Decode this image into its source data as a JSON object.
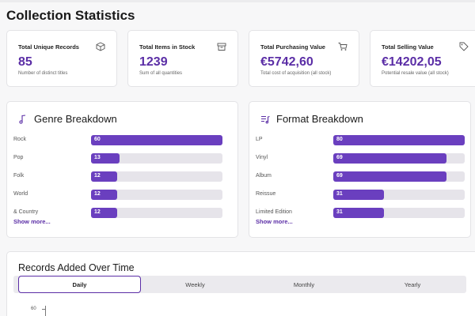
{
  "page": {
    "title": "Collection Statistics"
  },
  "stats": [
    {
      "label": "Total Unique Records",
      "value": "85",
      "sub": "Number of distinct titles",
      "icon": "box-icon"
    },
    {
      "label": "Total Items in Stock",
      "value": "1239",
      "sub": "Sum of all quantities",
      "icon": "archive-icon"
    },
    {
      "label": "Total Purchasing Value",
      "value": "€5742,60",
      "sub": "Total cost of acquisition (all stock)",
      "icon": "cart-icon"
    },
    {
      "label": "Total Selling Value",
      "value": "€14202,05",
      "sub": "Potential resale value (all stock)",
      "icon": "tag-icon"
    }
  ],
  "genre": {
    "title": "Genre Breakdown",
    "more": "Show more...",
    "max": 60,
    "items": [
      {
        "label": "Rock",
        "value": 60
      },
      {
        "label": "Pop",
        "value": 13
      },
      {
        "label": "Folk",
        "value": 12
      },
      {
        "label": "World",
        "value": 12
      },
      {
        "label": "& Country",
        "value": 12
      }
    ]
  },
  "format": {
    "title": "Format Breakdown",
    "more": "Show more...",
    "max": 80,
    "items": [
      {
        "label": "LP",
        "value": 80
      },
      {
        "label": "Vinyl",
        "value": 69
      },
      {
        "label": "Album",
        "value": 69
      },
      {
        "label": "Reissue",
        "value": 31
      },
      {
        "label": "Limited Edition",
        "value": 31
      }
    ]
  },
  "timeline": {
    "title": "Records Added Over Time",
    "tabs": [
      "Daily",
      "Weekly",
      "Monthly",
      "Yearly"
    ],
    "active_tab": "Daily",
    "y_tick": "60"
  },
  "colors": {
    "accent": "#5b2ea6",
    "bar": "#6a3fbf",
    "track": "#e6e4ea"
  }
}
